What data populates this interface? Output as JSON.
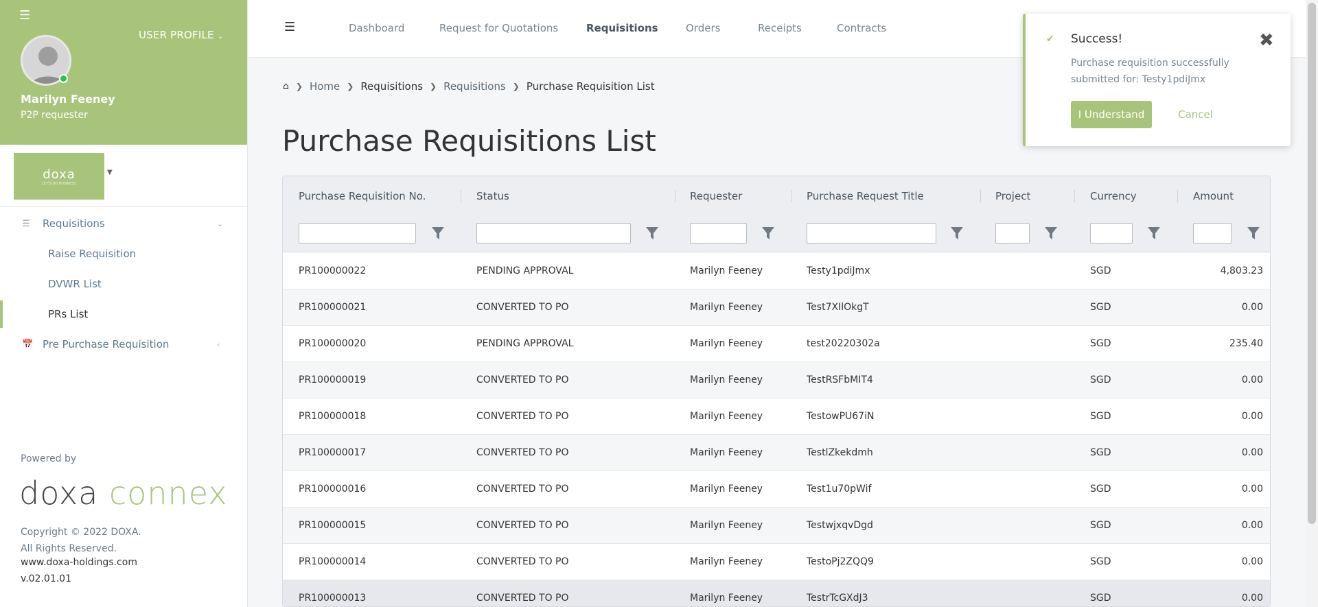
{
  "sidebar": {
    "user_profile_label": "USER PROFILE",
    "user_name": "Marilyn Feeney",
    "user_role": "P2P requester",
    "company_logo": "doxa",
    "company_tagline": "LET'S DO BUSINESS",
    "nav": {
      "requisitions": "Requisitions",
      "raise": "Raise Requisition",
      "dvwr": "DVWR List",
      "prs": "PRs List",
      "pre_purchase": "Pre Purchase Requisition"
    },
    "powered_by": "Powered by",
    "brand_part1": "doxa",
    "brand_part2": "connex",
    "copyright_line1": "Copyright © 2022 DOXA.",
    "copyright_line2": "All Rights Reserved.",
    "website": "www.doxa-holdings.com",
    "version": "v.02.01.01"
  },
  "topbar": {
    "tabs": [
      "Dashboard",
      "Request for Quotations",
      "Requisitions",
      "Orders",
      "Receipts",
      "Contracts"
    ]
  },
  "breadcrumb": [
    "Home",
    "Requisitions",
    "Requisitions",
    "Purchase Requisition List"
  ],
  "page_title": "Purchase Requisitions List",
  "table": {
    "columns": [
      "Purchase Requisition No.",
      "Status",
      "Requester",
      "Purchase Request Title",
      "Project",
      "Currency",
      "Amount"
    ],
    "rows": [
      [
        "PR100000022",
        "PENDING APPROVAL",
        "Marilyn Feeney",
        "Testy1pdiJmx",
        "",
        "SGD",
        "4,803.23"
      ],
      [
        "PR100000021",
        "CONVERTED TO PO",
        "Marilyn Feeney",
        "Test7XIlOkgT",
        "",
        "SGD",
        "0.00"
      ],
      [
        "PR100000020",
        "PENDING APPROVAL",
        "Marilyn Feeney",
        "test20220302a",
        "",
        "SGD",
        "235.40"
      ],
      [
        "PR100000019",
        "CONVERTED TO PO",
        "Marilyn Feeney",
        "TestRSFbMIT4",
        "",
        "SGD",
        "0.00"
      ],
      [
        "PR100000018",
        "CONVERTED TO PO",
        "Marilyn Feeney",
        "TestowPU67iN",
        "",
        "SGD",
        "0.00"
      ],
      [
        "PR100000017",
        "CONVERTED TO PO",
        "Marilyn Feeney",
        "TestlZkekdmh",
        "",
        "SGD",
        "0.00"
      ],
      [
        "PR100000016",
        "CONVERTED TO PO",
        "Marilyn Feeney",
        "Test1u70pWif",
        "",
        "SGD",
        "0.00"
      ],
      [
        "PR100000015",
        "CONVERTED TO PO",
        "Marilyn Feeney",
        "TestwjxqvDgd",
        "",
        "SGD",
        "0.00"
      ],
      [
        "PR100000014",
        "CONVERTED TO PO",
        "Marilyn Feeney",
        "TestoPj2ZQQ9",
        "",
        "SGD",
        "0.00"
      ],
      [
        "PR100000013",
        "CONVERTED TO PO",
        "Marilyn Feeney",
        "TestrTcGXdJ3",
        "",
        "SGD",
        "0.00"
      ]
    ]
  },
  "toast": {
    "title": "Success!",
    "message": "Purchase requisition successfully submitted for: Testy1pdiJmx",
    "ok_label": "I Understand",
    "cancel_label": "Cancel"
  },
  "colors": {
    "accent": "#a8c47a",
    "header_bg": "#eceef1"
  }
}
